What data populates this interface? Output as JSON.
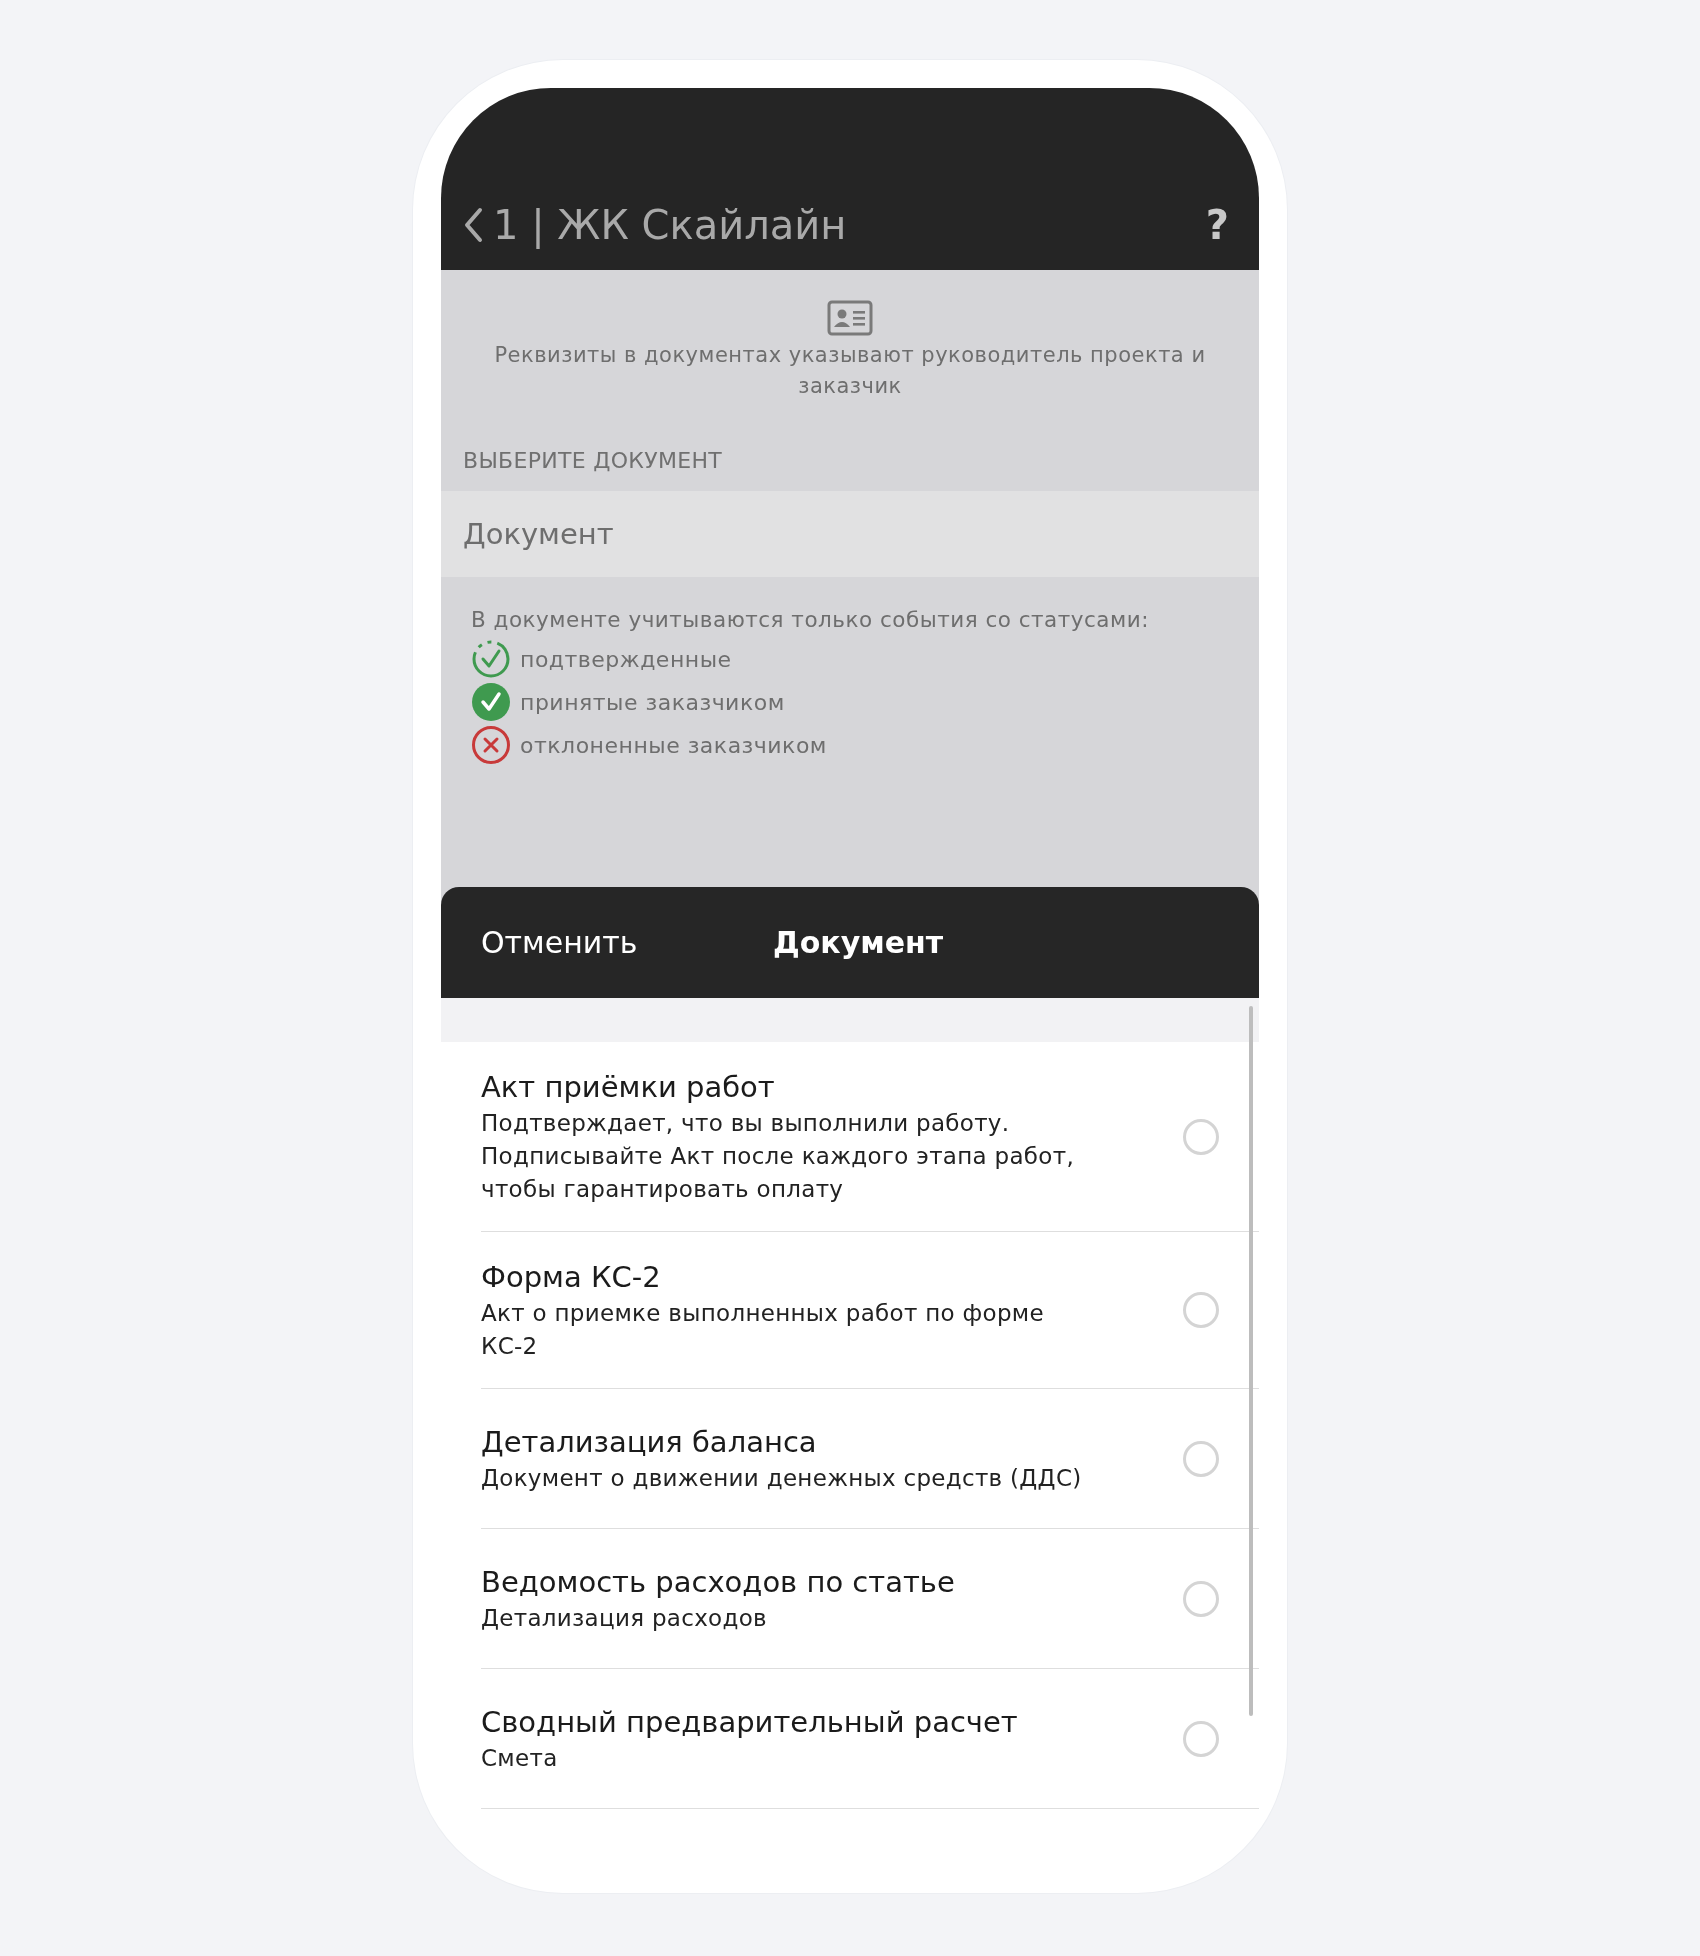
{
  "header": {
    "back_label": "1 | ЖК Скайлайн",
    "help": "?"
  },
  "notice": "Реквизиты в документах указывают руководитель проекта и заказчик",
  "section_label": "ВЫБЕРИТЕ ДОКУМЕНТ",
  "document_field": {
    "value": "Документ"
  },
  "status_intro": "В документе учитываются только события со статусами:",
  "statuses": [
    {
      "kind": "confirmed",
      "label": "подтвержденные"
    },
    {
      "kind": "accepted",
      "label": "принятые заказчиком"
    },
    {
      "kind": "rejected",
      "label": "отклоненные заказчиком"
    }
  ],
  "sheet": {
    "cancel": "Отменить",
    "title": "Документ"
  },
  "options": [
    {
      "title": "Акт приёмки работ",
      "subtitle": "Подтверждает, что вы выполнили работу.\nПодписывайте Акт после каждого этапа работ,\nчтобы гарантировать оплату",
      "selected": false
    },
    {
      "title": "Форма КС-2",
      "subtitle": "Акт о приемке выполненных работ по форме\nКС-2",
      "selected": false
    },
    {
      "title": "Детализация баланса",
      "subtitle": "Документ о движении денежных средств (ДДС)",
      "selected": false
    },
    {
      "title": "Ведомость расходов по статье",
      "subtitle": "Детализация расходов",
      "selected": false
    },
    {
      "title": "Сводный предварительный расчет",
      "subtitle": "Смета",
      "selected": false
    }
  ]
}
